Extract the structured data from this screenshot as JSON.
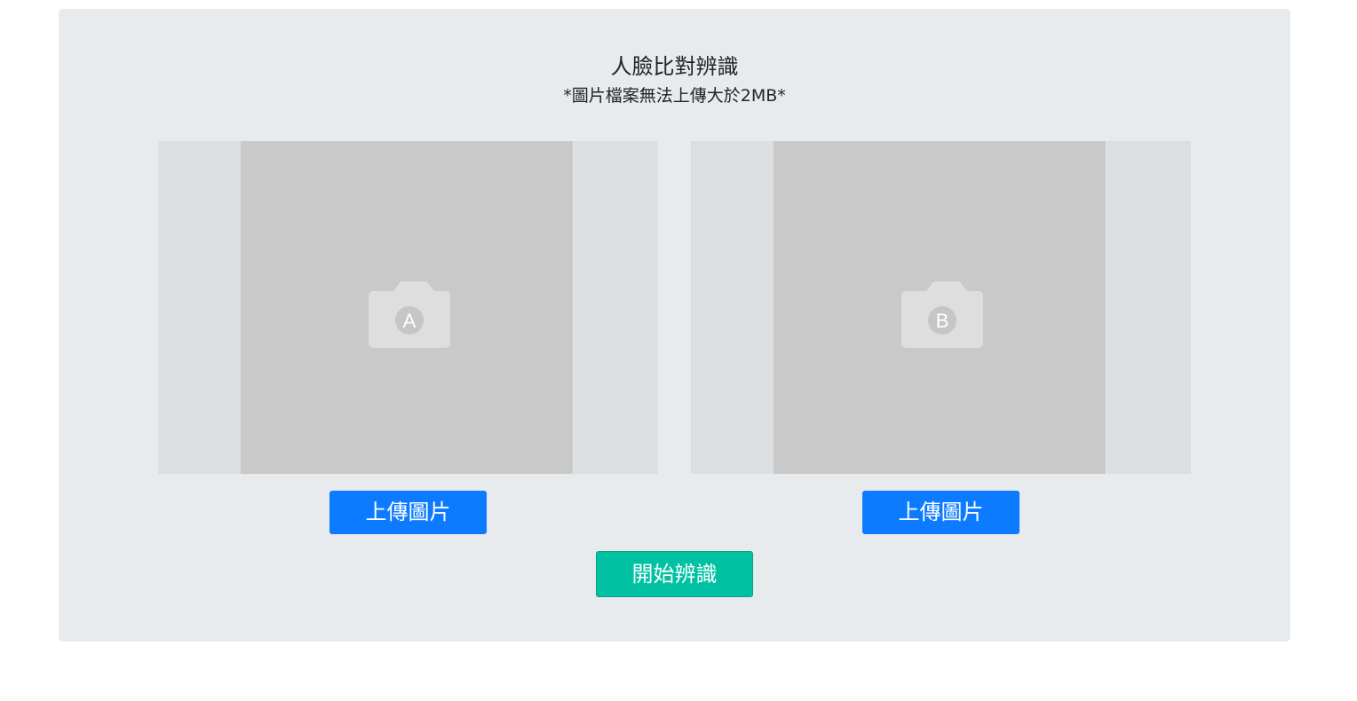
{
  "header": {
    "title": "人臉比對辨識",
    "subtitle": "*圖片檔案無法上傳大於2MB*"
  },
  "slots": [
    {
      "icon": "camera-icon",
      "letter": "A",
      "upload_label": "上傳圖片"
    },
    {
      "icon": "camera-icon",
      "letter": "B",
      "upload_label": "上傳圖片"
    }
  ],
  "actions": {
    "start_label": "開始辨識"
  },
  "colors": {
    "panel_bg": "#e7ebee",
    "upload_button": "#0d7bff",
    "start_button": "#00c2a3",
    "placeholder": "#c9c9c9"
  }
}
